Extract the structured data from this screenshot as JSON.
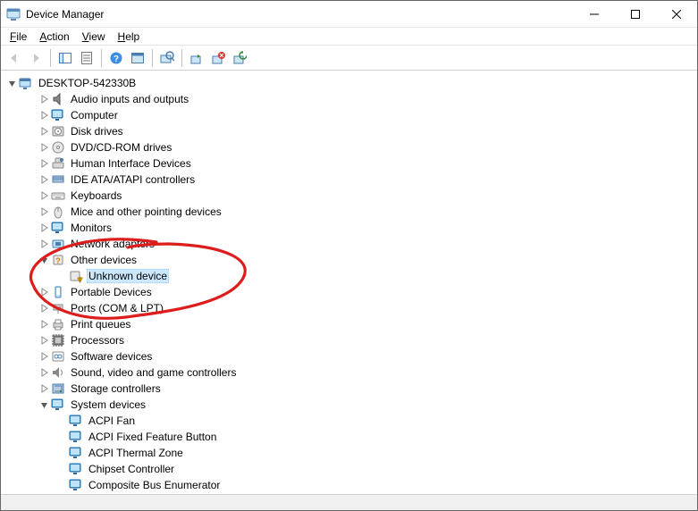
{
  "window": {
    "title": "Device Manager"
  },
  "menu": {
    "file": "File",
    "action": "Action",
    "view": "View",
    "help": "Help"
  },
  "tree": {
    "root": "DESKTOP-542330B",
    "items": [
      {
        "icon": "audio",
        "label": "Audio inputs and outputs"
      },
      {
        "icon": "computer",
        "label": "Computer"
      },
      {
        "icon": "disk",
        "label": "Disk drives"
      },
      {
        "icon": "dvd",
        "label": "DVD/CD-ROM drives"
      },
      {
        "icon": "hid",
        "label": "Human Interface Devices"
      },
      {
        "icon": "ide",
        "label": "IDE ATA/ATAPI controllers"
      },
      {
        "icon": "keyboard",
        "label": "Keyboards"
      },
      {
        "icon": "mouse",
        "label": "Mice and other pointing devices"
      },
      {
        "icon": "monitor",
        "label": "Monitors"
      },
      {
        "icon": "network",
        "label": "Network adapters"
      },
      {
        "icon": "other",
        "label": "Other devices",
        "open": true
      },
      {
        "icon": "unknown",
        "label": "Unknown device",
        "indent": 1,
        "selected": true
      },
      {
        "icon": "portable",
        "label": "Portable Devices"
      },
      {
        "icon": "ports",
        "label": "Ports (COM & LPT)"
      },
      {
        "icon": "printer",
        "label": "Print queues"
      },
      {
        "icon": "cpu",
        "label": "Processors"
      },
      {
        "icon": "software",
        "label": "Software devices"
      },
      {
        "icon": "sound",
        "label": "Sound, video and game controllers"
      },
      {
        "icon": "storage",
        "label": "Storage controllers"
      },
      {
        "icon": "system",
        "label": "System devices",
        "open": true
      },
      {
        "icon": "systemdev",
        "label": "ACPI Fan",
        "indent": 1
      },
      {
        "icon": "systemdev",
        "label": "ACPI Fixed Feature Button",
        "indent": 1
      },
      {
        "icon": "systemdev",
        "label": "ACPI Thermal Zone",
        "indent": 1
      },
      {
        "icon": "systemdev",
        "label": "Chipset Controller",
        "indent": 1
      },
      {
        "icon": "systemdev",
        "label": "Composite Bus Enumerator",
        "indent": 1
      }
    ]
  }
}
